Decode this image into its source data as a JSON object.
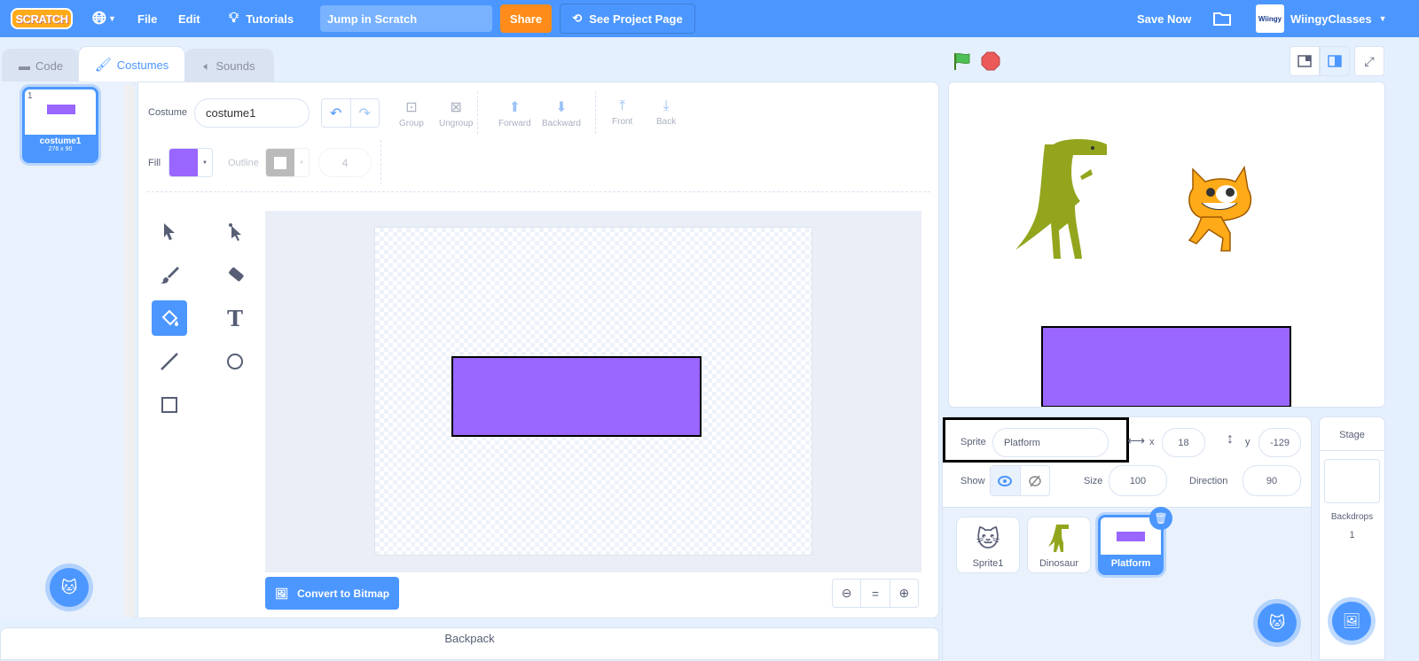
{
  "menubar": {
    "logo": "SCRATCH",
    "file": "File",
    "edit": "Edit",
    "tutorials": "Tutorials",
    "project_title": "Jump in Scratch",
    "share": "Share",
    "see_project_page": "See Project Page",
    "save_now": "Save Now",
    "username": "WiingyClasses",
    "avatar_text": "Wiingy"
  },
  "tabs": [
    {
      "label": "Code"
    },
    {
      "label": "Costumes",
      "active": true
    },
    {
      "label": "Sounds"
    }
  ],
  "costumes": [
    {
      "index": "1",
      "name": "costume1",
      "size": "276 x 90"
    }
  ],
  "paint": {
    "costume_label": "Costume",
    "costume_name": "costume1",
    "group": "Group",
    "ungroup": "Ungroup",
    "forward": "Forward",
    "backward": "Backward",
    "front": "Front",
    "back": "Back",
    "fill_label": "Fill",
    "fill_color": "#9966ff",
    "outline_label": "Outline",
    "outline_width": "4",
    "convert_button": "Convert to Bitmap",
    "zoom_reset": "="
  },
  "sprite_info": {
    "sprite_label": "Sprite",
    "sprite_name": "Platform",
    "x_label": "x",
    "x": "18",
    "y_label": "y",
    "y": "-129",
    "show_label": "Show",
    "size_label": "Size",
    "size": "100",
    "direction_label": "Direction",
    "direction": "90"
  },
  "sprites": [
    {
      "name": "Sprite1"
    },
    {
      "name": "Dinosaur"
    },
    {
      "name": "Platform",
      "selected": true
    }
  ],
  "stage_panel": {
    "title": "Stage",
    "backdrops_label": "Backdrops",
    "backdrops_count": "1"
  },
  "backpack": "Backpack",
  "colors": {
    "accent": "#4c97ff",
    "share": "#ff8c1a",
    "platform": "#9966ff"
  }
}
